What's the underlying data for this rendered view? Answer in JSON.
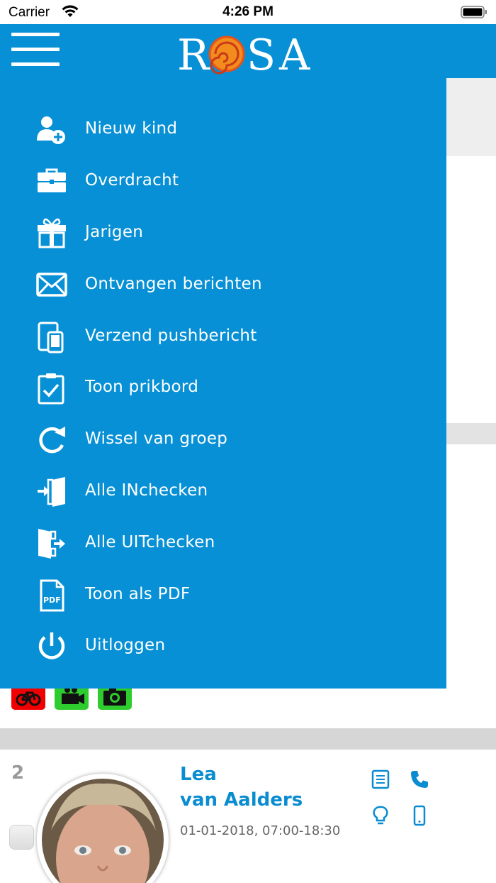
{
  "status_bar": {
    "carrier": "Carrier",
    "time": "4:26 PM",
    "wifi_icon": "wifi-icon",
    "battery_icon": "battery-icon"
  },
  "header": {
    "menu_icon": "hamburger-menu-icon",
    "logo_text": "ROSA",
    "brand_color": "#0790d5"
  },
  "drawer": {
    "items": [
      {
        "label": "Nieuw kind",
        "icon": "add-user-icon"
      },
      {
        "label": "Overdracht",
        "icon": "briefcase-icon"
      },
      {
        "label": "Jarigen",
        "icon": "gift-icon"
      },
      {
        "label": "Ontvangen berichten",
        "icon": "envelope-icon"
      },
      {
        "label": "Verzend pushbericht",
        "icon": "devices-icon"
      },
      {
        "label": "Toon prikbord",
        "icon": "clipboard-check-icon"
      },
      {
        "label": "Wissel van groep",
        "icon": "refresh-icon"
      },
      {
        "label": "Alle INchecken",
        "icon": "sign-in-icon"
      },
      {
        "label": "Alle UITchecken",
        "icon": "sign-out-icon"
      },
      {
        "label": "Toon als PDF",
        "icon": "pdf-icon"
      },
      {
        "label": "Uitloggen",
        "icon": "power-icon"
      }
    ]
  },
  "background": {
    "mode_icons": [
      {
        "icon": "bicycle-icon",
        "color": "#f00000"
      },
      {
        "icon": "video-camera-icon",
        "color": "#2ecc2e"
      },
      {
        "icon": "camera-icon",
        "color": "#2ecc2e"
      }
    ],
    "child": {
      "number": "2",
      "first_name": "Lea",
      "last_name": "van Aalders",
      "date_time": "01-01-2018, 07:00-18:30",
      "actions": [
        "notes-icon",
        "phone-icon",
        "lightbulb-icon",
        "mobile-icon"
      ]
    }
  }
}
